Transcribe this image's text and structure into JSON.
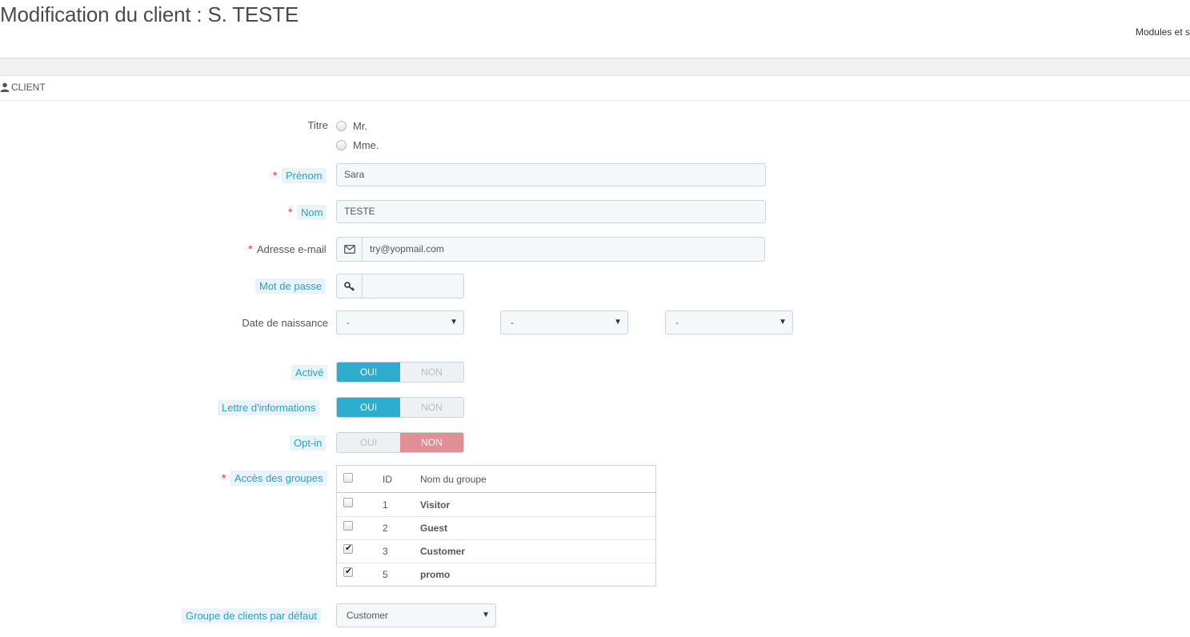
{
  "page": {
    "title": "Modification du client : S. TESTE",
    "top_right_link": "Modules et s"
  },
  "panel": {
    "heading": "CLIENT",
    "icon": "user-icon"
  },
  "form": {
    "titre": {
      "label": "Titre",
      "options": [
        "Mr.",
        "Mme."
      ],
      "selected": null
    },
    "prenom": {
      "label": "Prénom",
      "required": true,
      "value": "Sara"
    },
    "nom": {
      "label": "Nom",
      "required": true,
      "value": "TESTE"
    },
    "email": {
      "label": "Adresse e-mail",
      "required": true,
      "value": "try@yopmail.com",
      "icon": "envelope-icon"
    },
    "password": {
      "label": "Mot de passe",
      "value": "",
      "icon": "key-icon"
    },
    "birthdate": {
      "label": "Date de naissance",
      "day": "-",
      "month": "-",
      "year": "-"
    },
    "active": {
      "label": "Activé",
      "yes": "OUI",
      "no": "NON",
      "value": "OUI"
    },
    "newsletter": {
      "label": "Lettre d'informations",
      "yes": "OUI",
      "no": "NON",
      "value": "OUI"
    },
    "optin": {
      "label": "Opt-in",
      "yes": "OUI",
      "no": "NON",
      "value": "NON"
    },
    "groups": {
      "label": "Accès des groupes",
      "required": true,
      "columns": [
        "ID",
        "Nom du groupe"
      ],
      "rows": [
        {
          "id": "1",
          "name": "Visitor",
          "checked": false
        },
        {
          "id": "2",
          "name": "Guest",
          "checked": false
        },
        {
          "id": "3",
          "name": "Customer",
          "checked": true
        },
        {
          "id": "5",
          "name": "promo",
          "checked": true
        }
      ]
    },
    "default_group": {
      "label": "Groupe de clients par défaut",
      "value": "Customer"
    }
  },
  "colors": {
    "accent": "#2eacce",
    "danger": "#e08f95",
    "required": "#e3354c",
    "help_label": "#25a2c9"
  }
}
